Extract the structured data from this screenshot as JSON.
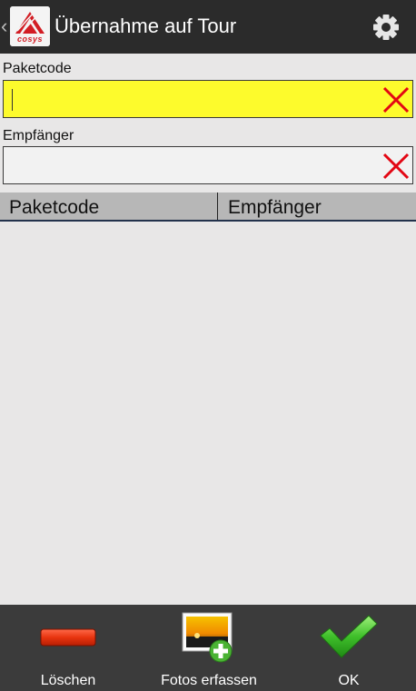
{
  "app": {
    "title": "Übernahme auf Tour",
    "logo_text": "cosys",
    "colors": {
      "actionbar": "#2b2b2b",
      "accent_red": "#e30613",
      "field_active": "#fdfb2c"
    }
  },
  "form": {
    "paketcode": {
      "label": "Paketcode",
      "value": "",
      "placeholder": ""
    },
    "empfaenger": {
      "label": "Empfänger",
      "value": "",
      "placeholder": ""
    }
  },
  "table": {
    "columns": [
      "Paketcode",
      "Empfänger"
    ],
    "rows": []
  },
  "bottom_bar": {
    "delete_label": "Löschen",
    "photos_label": "Fotos erfassen",
    "ok_label": "OK"
  },
  "icons": {
    "back": "chevron-left-icon",
    "logo": "cosys-logo",
    "settings": "gear-icon",
    "clear": "close-icon",
    "delete": "minus-icon",
    "photos": "add-photo-icon",
    "ok": "checkmark-icon"
  }
}
